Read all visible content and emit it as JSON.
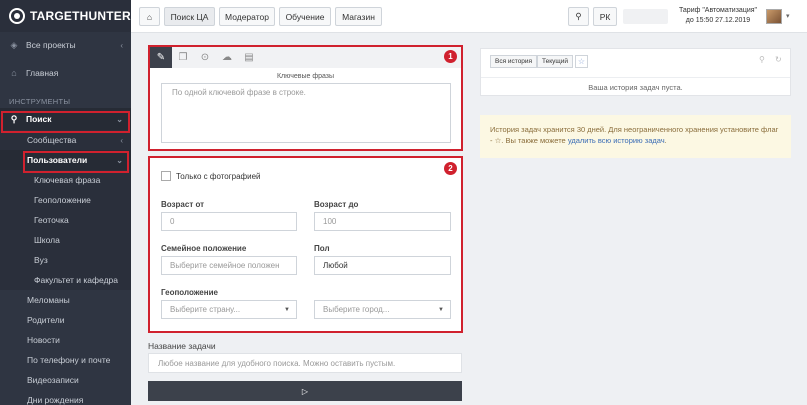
{
  "app": {
    "logo_text": "TARGETHUNTER"
  },
  "sidebar": {
    "all_projects": "Все проекты",
    "home": "Главная",
    "tools_section": "ИНСТРУМЕНТЫ",
    "search": "Поиск",
    "communities": "Сообщества",
    "users": "Пользователи",
    "sub_items": [
      "Ключевая фраза",
      "Геоположение",
      "Геоточка",
      "Школа",
      "Вуз",
      "Факультет и кафедра"
    ],
    "items": [
      "Меломаны",
      "Родители",
      "Новости",
      "По телефону и почте",
      "Видеозаписи",
      "Дни рождения"
    ]
  },
  "topbar": {
    "home_icon": "home-icon",
    "tabs": [
      "Поиск ЦА",
      "Модератор",
      "Обучение",
      "Магазин"
    ],
    "search_icon": "search-icon",
    "pk_label": "РК",
    "tariff_line1": "Тариф \"Автоматизация\"",
    "tariff_line2": "до 15:50 27.12.2019"
  },
  "form": {
    "badge1": "1",
    "badge2": "2",
    "tab_icons": [
      "edit-icon",
      "copy-icon",
      "map-pin-icon",
      "cloud-upload-icon",
      "book-icon"
    ],
    "keywords_label": "Ключевые фразы",
    "keywords_placeholder": "По одной ключевой фразе в строке.",
    "only_photo": "Только с фотографией",
    "age_from_label": "Возраст от",
    "age_from_value": "0",
    "age_to_label": "Возраст до",
    "age_to_value": "100",
    "family_label": "Семейное положение",
    "family_placeholder": "Выберите семейное положен",
    "gender_label": "Пол",
    "gender_value": "Любой",
    "geo_label": "Геоположение",
    "country_placeholder": "Выберите страну...",
    "city_placeholder": "Выберите город...",
    "task_name_label": "Название задачи",
    "task_name_placeholder": "Любое название для удобного поиска. Можно оставить пустым."
  },
  "history": {
    "tab_all": "Вся история",
    "tab_current": "Текущий",
    "empty": "Ваша история задач пуста.",
    "notice_text": "История задач хранится 30 дней. Для неограниченного хранения установите флаг - ☆. Вы также можете",
    "notice_link": "удалить всю историю задач",
    "notice_end": "."
  },
  "colors": {
    "accent_red": "#d0212e",
    "sidebar_bg": "#2f3542",
    "notice_bg": "#fcf8e3"
  }
}
